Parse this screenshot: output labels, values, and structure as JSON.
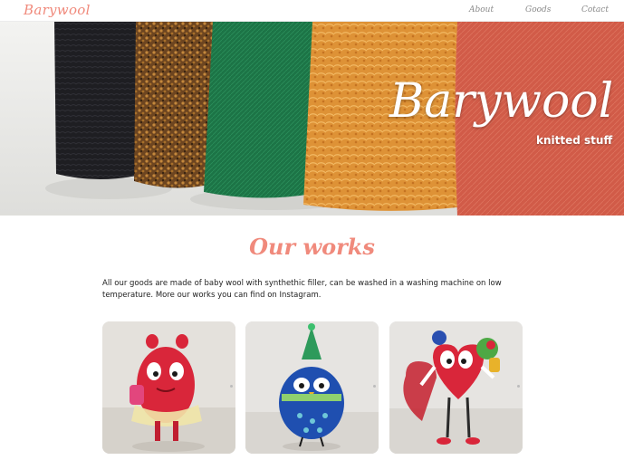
{
  "header": {
    "logo": "Barywool",
    "nav": [
      "About",
      "Goods",
      "Cotact"
    ]
  },
  "hero": {
    "title": "Barywool",
    "subtitle": "knitted stuff",
    "yarn_colors": [
      "#1f1f21",
      "#8a5a2b",
      "#1f7a4a",
      "#e09a3c",
      "#d7644e"
    ]
  },
  "works": {
    "title": "Our works",
    "description": "All our goods are made of baby wool with synthethic filler, can be washed in a washing machine on low temperature. More our works you can find on Instagram."
  },
  "gallery": {
    "items": [
      {
        "subject": "red monster toy with tutu",
        "color": "#d9263a"
      },
      {
        "subject": "blue owl toy with party hat",
        "color": "#1f4fb0"
      },
      {
        "subject": "red heart character toy",
        "color": "#d9263a"
      }
    ]
  },
  "colors": {
    "accent": "#f08a7c",
    "nav_text": "#8a8a8a",
    "body_text": "#222222"
  }
}
